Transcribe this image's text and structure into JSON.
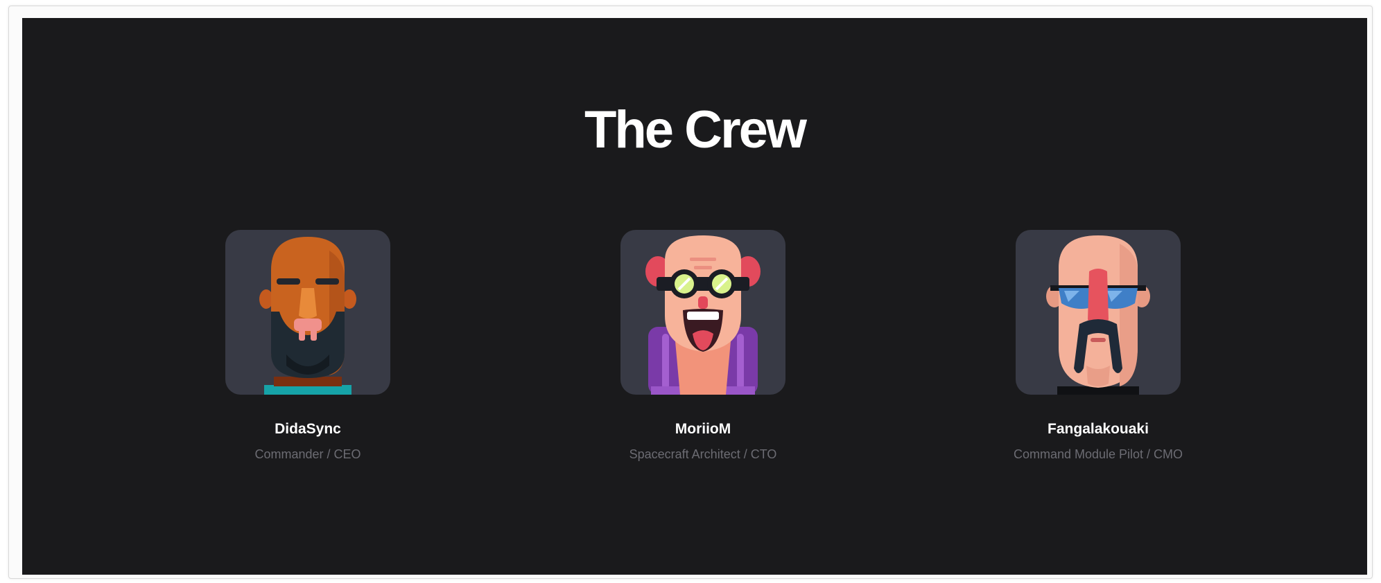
{
  "section": {
    "title": "The Crew"
  },
  "crew": [
    {
      "name": "DidaSync",
      "role": "Commander / CEO"
    },
    {
      "name": "MoriioM",
      "role": "Spacecraft Architect / CTO"
    },
    {
      "name": "Fangalakouaki",
      "role": "Command Module Pilot / CMO"
    }
  ],
  "colors": {
    "page_background": "#1a1a1c",
    "avatar_card": "#383a45",
    "name_text": "#ffffff",
    "role_text": "#6c6c73"
  }
}
